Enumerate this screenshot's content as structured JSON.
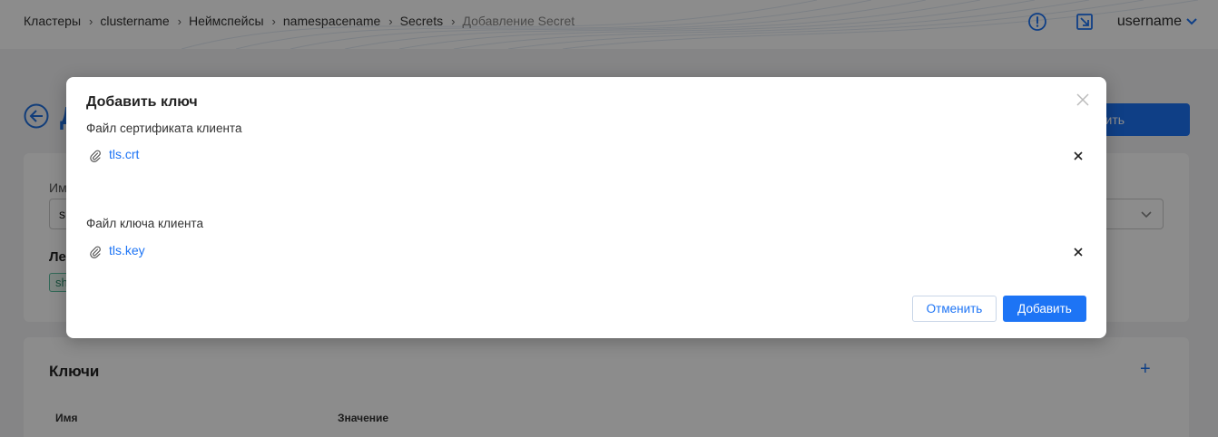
{
  "header": {
    "breadcrumb": [
      {
        "label": "Кластеры"
      },
      {
        "label": "clustername"
      },
      {
        "label": "Неймспейсы"
      },
      {
        "label": "namespacename"
      },
      {
        "label": "Secrets"
      },
      {
        "label": "Добавление Secret"
      }
    ],
    "username": "username",
    "icons": [
      "alert-circle-icon",
      "open-external-icon",
      "chevron-down-icon"
    ]
  },
  "page": {
    "title_partial": "Д",
    "save_button_partial": "анить",
    "name_label_partial": "Им",
    "name_value_partial": "s",
    "labels_heading_partial": "Ле",
    "tag_partial": "sh",
    "keys_title": "Ключи",
    "keys_add": "+",
    "keys_columns": [
      "Имя",
      "Значение"
    ]
  },
  "modal": {
    "title": "Добавить ключ",
    "sections": [
      {
        "label": "Файл сертификата клиента",
        "file": "tls.crt"
      },
      {
        "label": "Файл ключа клиента",
        "file": "tls.key"
      }
    ],
    "cancel_label": "Отменить",
    "submit_label": "Добавить"
  },
  "colors": {
    "accent": "#1d74f5",
    "overlay": "rgba(0,0,0,0.45)"
  }
}
